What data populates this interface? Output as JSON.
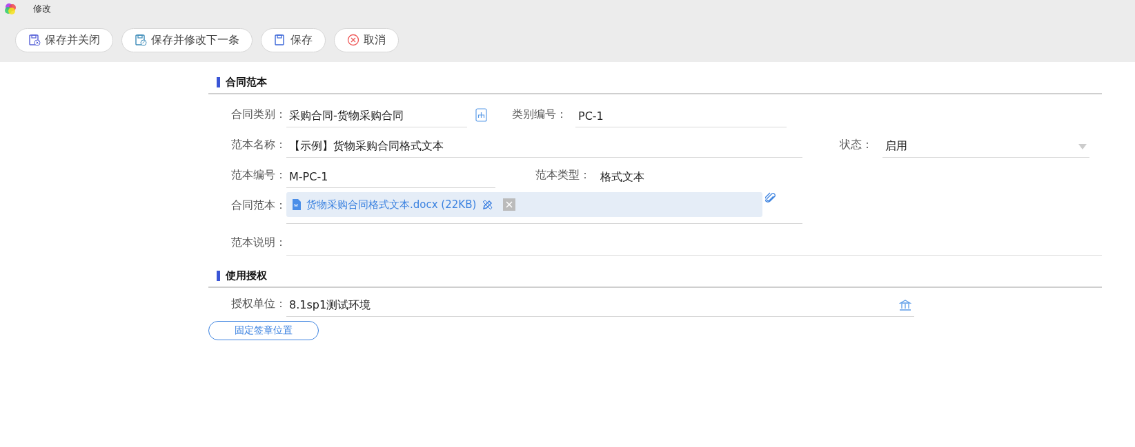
{
  "window": {
    "title": "修改"
  },
  "toolbar": [
    {
      "kind": "save-close",
      "label": "保存并关闭"
    },
    {
      "kind": "save-next",
      "label": "保存并修改下一条"
    },
    {
      "kind": "save",
      "label": "保存"
    },
    {
      "kind": "cancel",
      "label": "取消"
    }
  ],
  "template": {
    "title": "合同范本",
    "category": {
      "label": "合同类别：",
      "value": "采购合同-货物采购合同"
    },
    "category_code": {
      "label": "类别编号：",
      "value": "PC-1"
    },
    "name": {
      "label": "范本名称：",
      "value": "【示例】货物采购合同格式文本"
    },
    "status": {
      "label": "状态：",
      "value": "启用"
    },
    "code": {
      "label": "范本编号：",
      "value": "M-PC-1"
    },
    "type": {
      "label": "范本类型：",
      "value": "格式文本"
    },
    "file": {
      "label": "合同范本：",
      "name": "货物采购合同格式文本.docx (22KB)"
    },
    "description": {
      "label": "范本说明："
    }
  },
  "authorization": {
    "title": "使用授权",
    "unit": {
      "label": "授权单位：",
      "value": "8.1sp1测试环境"
    }
  },
  "seal_button": "固定签章位置"
}
